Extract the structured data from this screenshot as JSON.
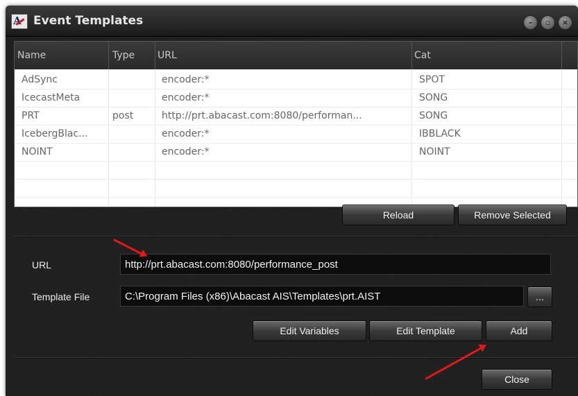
{
  "window": {
    "title": "Event Templates",
    "logo_text": "A",
    "controls": {
      "minimize": "–",
      "restore": "▫",
      "close": "×"
    }
  },
  "grid": {
    "columns": [
      "Name",
      "Type",
      "URL",
      "Cat"
    ],
    "rows": [
      [
        "AdSync",
        "",
        "encoder:*",
        "SPOT"
      ],
      [
        "IcecastMeta",
        "",
        "encoder:*",
        "SONG"
      ],
      [
        "PRT",
        "post",
        "http://prt.abacast.com:8080/performan...",
        "SONG"
      ],
      [
        "IcebergBlac...",
        "",
        "encoder:*",
        "IBBLACK"
      ],
      [
        "NOINT",
        "",
        "encoder:*",
        "NOINT"
      ]
    ]
  },
  "buttons": {
    "reload": "Reload",
    "remove_selected": "Remove Selected",
    "browse": "...",
    "edit_variables": "Edit Variables",
    "edit_template": "Edit Template",
    "add": "Add",
    "close": "Close"
  },
  "form": {
    "url_label": "URL",
    "url_value": "http://prt.abacast.com:8080/performance_post",
    "template_label": "Template File",
    "template_value": "C:\\Program Files (x86)\\Abacast AIS\\Templates\\prt.AIST"
  },
  "colors": {
    "annotation_arrow": "#e01a1a",
    "window_bg": "#1d1d1d",
    "grid_bg": "#ffffff"
  }
}
